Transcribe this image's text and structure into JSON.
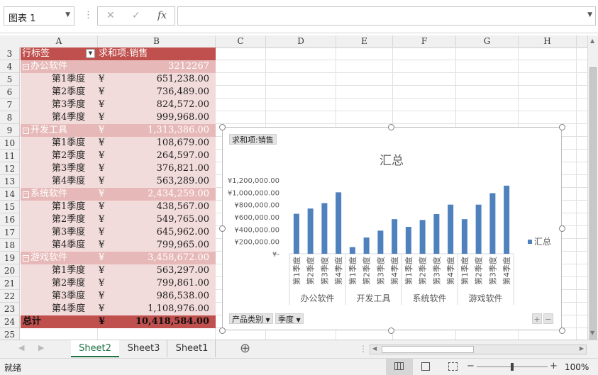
{
  "formula_bar": {
    "name_box": "图表 1",
    "cancel_icon": "✕",
    "enter_icon": "✓",
    "function_icon": "fx",
    "formula_value": ""
  },
  "columns": [
    "A",
    "B",
    "C",
    "D",
    "E",
    "F",
    "G",
    "H"
  ],
  "rows": [
    "3",
    "4",
    "5",
    "6",
    "7",
    "8",
    "9",
    "10",
    "11",
    "12",
    "13",
    "14",
    "15",
    "16",
    "17",
    "18",
    "19",
    "20",
    "21",
    "22",
    "23",
    "24",
    "25"
  ],
  "pivot": {
    "header": {
      "row_label": "行标签",
      "value_label": "求和项:销售"
    },
    "rows": [
      {
        "type": "group",
        "label": "办公软件",
        "currency": "",
        "value": "3212267"
      },
      {
        "type": "item",
        "label": "第1季度",
        "currency": "¥",
        "value": "651,238.00"
      },
      {
        "type": "item",
        "label": "第2季度",
        "currency": "¥",
        "value": "736,489.00"
      },
      {
        "type": "item",
        "label": "第3季度",
        "currency": "¥",
        "value": "824,572.00"
      },
      {
        "type": "item",
        "label": "第4季度",
        "currency": "¥",
        "value": "999,968.00"
      },
      {
        "type": "group",
        "label": "开发工具",
        "currency": "¥",
        "value": "1,313,386.00"
      },
      {
        "type": "item",
        "label": "第1季度",
        "currency": "¥",
        "value": "108,679.00"
      },
      {
        "type": "item",
        "label": "第2季度",
        "currency": "¥",
        "value": "264,597.00"
      },
      {
        "type": "item",
        "label": "第3季度",
        "currency": "¥",
        "value": "376,821.00"
      },
      {
        "type": "item",
        "label": "第4季度",
        "currency": "¥",
        "value": "563,289.00"
      },
      {
        "type": "group",
        "label": "系统软件",
        "currency": "¥",
        "value": "2,434,259.00"
      },
      {
        "type": "item",
        "label": "第1季度",
        "currency": "¥",
        "value": "438,567.00"
      },
      {
        "type": "item",
        "label": "第2季度",
        "currency": "¥",
        "value": "549,765.00"
      },
      {
        "type": "item",
        "label": "第3季度",
        "currency": "¥",
        "value": "645,962.00"
      },
      {
        "type": "item",
        "label": "第4季度",
        "currency": "¥",
        "value": "799,965.00"
      },
      {
        "type": "group",
        "label": "游戏软件",
        "currency": "¥",
        "value": "3,458,672.00"
      },
      {
        "type": "item",
        "label": "第1季度",
        "currency": "¥",
        "value": "563,297.00"
      },
      {
        "type": "item",
        "label": "第2季度",
        "currency": "¥",
        "value": "799,861.00"
      },
      {
        "type": "item",
        "label": "第3季度",
        "currency": "¥",
        "value": "986,538.00"
      },
      {
        "type": "item",
        "label": "第4季度",
        "currency": "¥",
        "value": "1,108,976.00"
      },
      {
        "type": "total",
        "label": "总计",
        "currency": "¥",
        "value": "10,418,584.00"
      }
    ]
  },
  "chart_data": {
    "type": "bar",
    "title": "汇总",
    "value_field_button": "求和项:销售",
    "legend": {
      "label": "汇总",
      "position": "right"
    },
    "axis_button_1": "产品类别",
    "axis_button_2": "季度",
    "color": "#4f81bd",
    "ylim": [
      0,
      1200000
    ],
    "y_ticks": [
      "¥-",
      "¥200,000.00",
      "¥400,000.00",
      "¥600,000.00",
      "¥800,000.00",
      "¥1,000,000.00",
      "¥1,200,000.00"
    ],
    "groups": [
      {
        "name": "办公软件",
        "categories": [
          "第1季度",
          "第2季度",
          "第3季度",
          "第4季度"
        ],
        "values": [
          651238,
          736489,
          824572,
          999968
        ]
      },
      {
        "name": "开发工具",
        "categories": [
          "第1季度",
          "第2季度",
          "第3季度",
          "第4季度"
        ],
        "values": [
          108679,
          264597,
          376821,
          563289
        ]
      },
      {
        "name": "系统软件",
        "categories": [
          "第1季度",
          "第2季度",
          "第3季度",
          "第4季度"
        ],
        "values": [
          438567,
          549765,
          645962,
          799965
        ]
      },
      {
        "name": "游戏软件",
        "categories": [
          "第1季度",
          "第2季度",
          "第3季度",
          "第4季度"
        ],
        "values": [
          563297,
          799861,
          986538,
          1108976
        ]
      }
    ]
  },
  "sheet_tabs": {
    "tabs": [
      "Sheet2",
      "Sheet3",
      "Sheet1"
    ],
    "active": "Sheet2",
    "add_icon": "⊕"
  },
  "status_bar": {
    "status": "就绪",
    "zoom": "100%"
  }
}
